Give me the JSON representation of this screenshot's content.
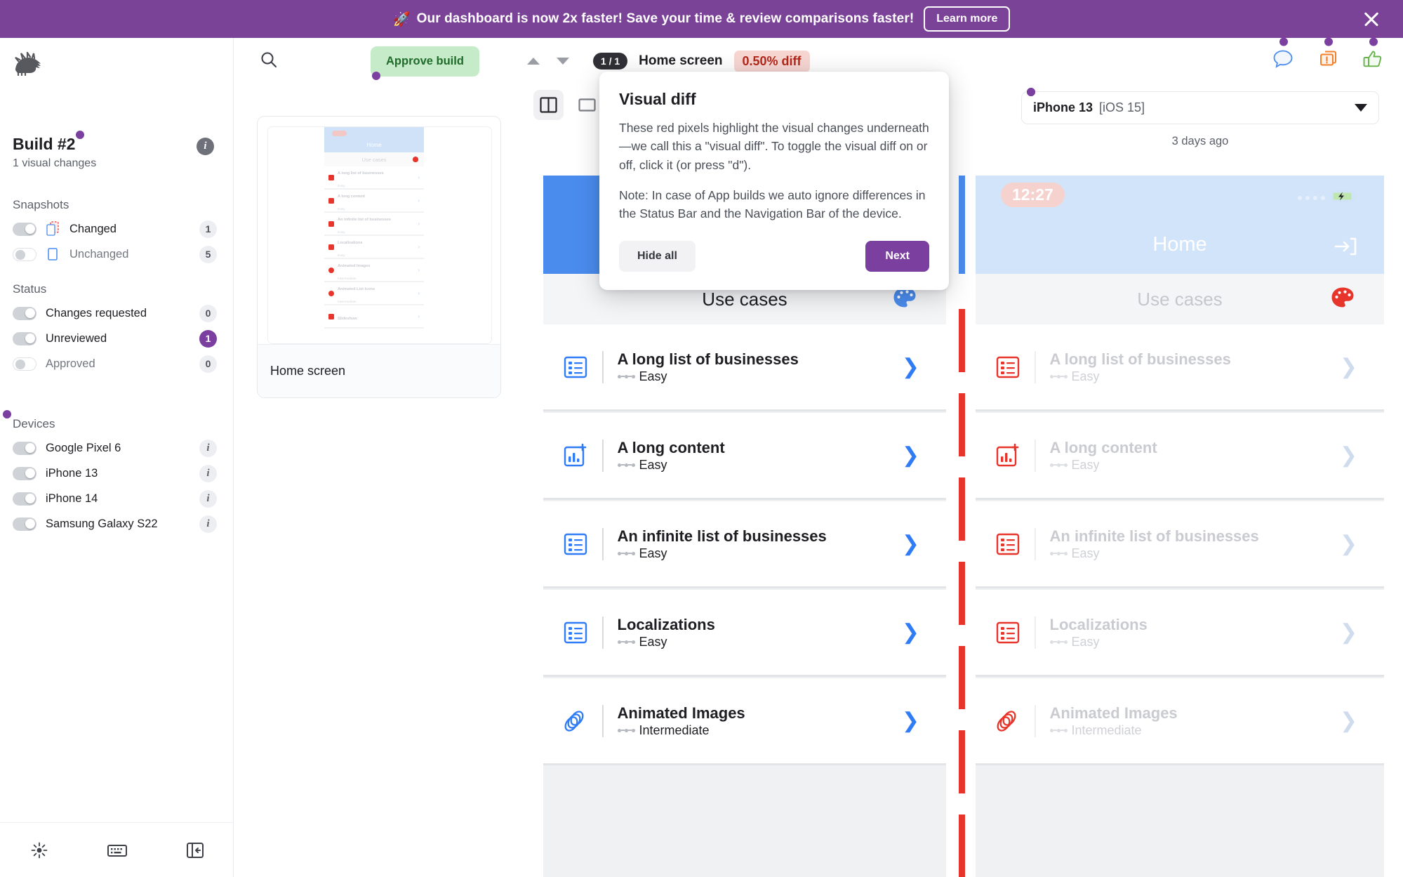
{
  "banner": {
    "icon": "rocket-icon",
    "text": "Our dashboard is now 2x faster! Save your time & review comparisons faster!",
    "cta": "Learn more",
    "close": "close-icon",
    "bg": "#7B4397"
  },
  "sidebar": {
    "logo": "porcupine-logo",
    "build": {
      "title": "Build #2",
      "subtitle": "1 visual changes",
      "info": "i"
    },
    "sections": [
      {
        "title": "Snapshots",
        "items": [
          {
            "label": "Changed",
            "toggle": "on",
            "badge": "1",
            "badge_style": "grey",
            "icon": "changed-snapshot-icon"
          },
          {
            "label": "Unchanged",
            "toggle": "off",
            "badge": "5",
            "badge_style": "grey",
            "icon": "unchanged-snapshot-icon"
          }
        ]
      },
      {
        "title": "Status",
        "items": [
          {
            "label": "Changes requested",
            "toggle": "on",
            "badge": "0",
            "badge_style": "grey"
          },
          {
            "label": "Unreviewed",
            "toggle": "on",
            "badge": "1",
            "badge_style": "purple"
          },
          {
            "label": "Approved",
            "toggle": "off",
            "badge": "0",
            "badge_style": "grey"
          }
        ]
      },
      {
        "title": "Devices",
        "has_dot": true,
        "items": [
          {
            "label": "Google Pixel 6",
            "toggle": "on",
            "info": "i"
          },
          {
            "label": "iPhone 13",
            "toggle": "on",
            "info": "i"
          },
          {
            "label": "iPhone 14",
            "toggle": "on",
            "info": "i"
          },
          {
            "label": "Samsung Galaxy S22",
            "toggle": "on",
            "info": "i"
          }
        ]
      }
    ],
    "footer_icons": [
      "brightness-icon",
      "keyboard-icon",
      "collapse-sidebar-icon"
    ]
  },
  "toolbar": {
    "search": "search-icon",
    "approve_label": "Approve build",
    "prev": "chevron-up-icon",
    "next": "chevron-down-icon",
    "page_counter": "1 / 1",
    "screen_title": "Home screen",
    "diff_percent": "0.50% diff",
    "right_icons": [
      "comment-icon",
      "request-changes-icon",
      "approve-icon"
    ],
    "view_modes": [
      "split-view-icon",
      "single-view-icon"
    ],
    "view_selected": 0
  },
  "device_selector": {
    "name": "iPhone 13",
    "os": "[iOS 15]",
    "timestamp": "3 days ago",
    "caret": "chevron-down-icon"
  },
  "thumbnail": {
    "label": "Home screen",
    "mini": {
      "header": "Home",
      "section": "Use cases",
      "rows": [
        {
          "title": "A long list of businesses",
          "sub": "Easy",
          "icon": "list-icon"
        },
        {
          "title": "A long content",
          "sub": "Easy",
          "icon": "chart-plus-icon"
        },
        {
          "title": "An infinite list of businesses",
          "sub": "Easy",
          "icon": "list-icon"
        },
        {
          "title": "Localizations",
          "sub": "Easy",
          "icon": "list-icon"
        },
        {
          "title": "Animated Images",
          "sub": "Intermediate",
          "icon": "rings-icon"
        },
        {
          "title": "Animated List Icons",
          "sub": "Intermediate",
          "icon": "rings-icon"
        },
        {
          "title": "Slideshow",
          "sub": "",
          "icon": "image-icon"
        }
      ]
    }
  },
  "panes": {
    "left": {
      "status_time": "",
      "header_title": "",
      "section_title": "Use cases",
      "palette": "palette-icon",
      "rows": [
        {
          "title": "A long list of businesses",
          "difficulty": "Easy",
          "icon": "list-icon",
          "chevron": "chevron-right-icon"
        },
        {
          "title": "A long content",
          "difficulty": "Easy",
          "icon": "chart-plus-icon",
          "chevron": "chevron-right-icon"
        },
        {
          "title": "An infinite list of businesses",
          "difficulty": "Easy",
          "icon": "list-icon",
          "chevron": "chevron-right-icon"
        },
        {
          "title": "Localizations",
          "difficulty": "Easy",
          "icon": "list-icon",
          "chevron": "chevron-right-icon"
        },
        {
          "title": "Animated Images",
          "difficulty": "Intermediate",
          "icon": "rings-icon",
          "chevron": "chevron-right-icon"
        }
      ]
    },
    "right": {
      "status_time": "12:27",
      "header_title": "Home",
      "exit_icon": "exit-icon",
      "battery_icon": "battery-charging-icon",
      "section_title": "Use cases",
      "palette": "palette-icon",
      "rows": [
        {
          "title": "A long list of businesses",
          "difficulty": "Easy",
          "icon": "list-icon",
          "chevron": "chevron-right-icon"
        },
        {
          "title": "A long content",
          "difficulty": "Easy",
          "icon": "chart-plus-icon",
          "chevron": "chevron-right-icon"
        },
        {
          "title": "An infinite list of businesses",
          "difficulty": "Easy",
          "icon": "list-icon",
          "chevron": "chevron-right-icon"
        },
        {
          "title": "Localizations",
          "difficulty": "Easy",
          "icon": "list-icon",
          "chevron": "chevron-right-icon"
        },
        {
          "title": "Animated Images",
          "difficulty": "Intermediate",
          "icon": "rings-icon",
          "chevron": "chevron-right-icon"
        }
      ]
    }
  },
  "tooltip": {
    "title": "Visual diff",
    "paragraph1": "These red pixels highlight the visual changes underneath—we call this a \"visual diff\". To toggle the visual diff on or off, click it (or press \"d\").",
    "paragraph2": "Note: In case of App builds we auto ignore differences in the Status Bar and the Navigation Bar of the device.",
    "hide_label": "Hide all",
    "next_label": "Next"
  },
  "colors": {
    "brand_purple": "#7B3FA0",
    "banner_purple": "#7B4397",
    "approve_green_bg": "#C5EBC8",
    "approve_green_text": "#1F6B29",
    "diff_red_bg": "#F7D6D2",
    "diff_red_text": "#B4281B",
    "diff_marker_red": "#E8352B",
    "accent_blue": "#2F7CF6"
  }
}
